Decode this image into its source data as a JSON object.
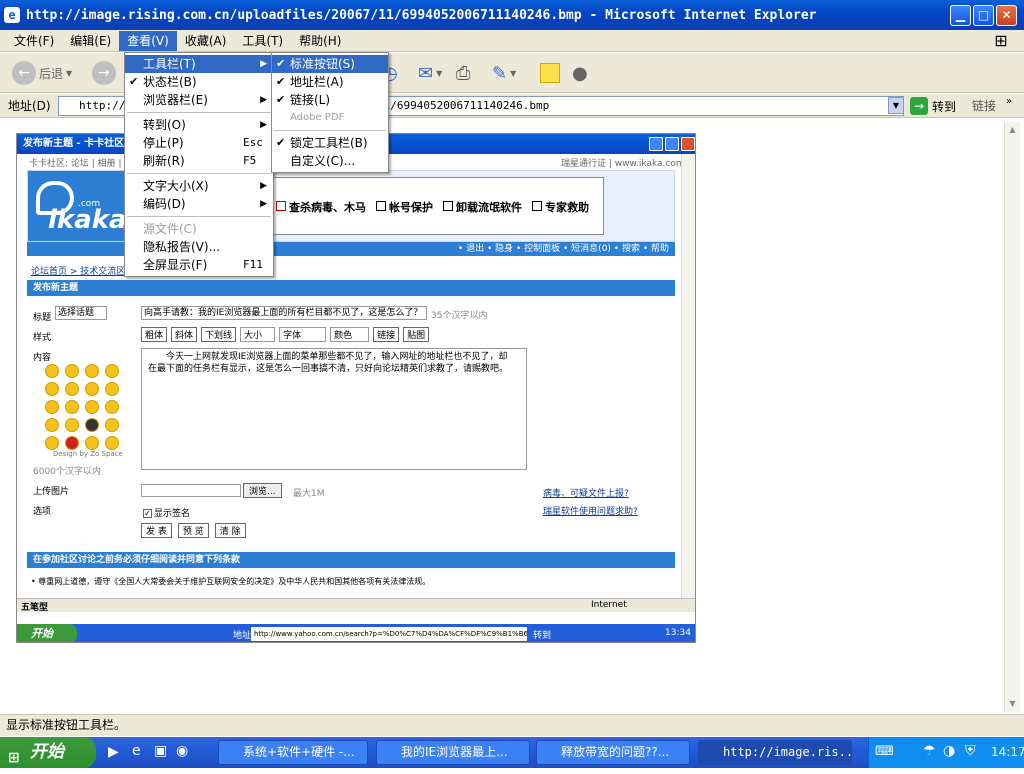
{
  "window": {
    "title": "http://image.rising.com.cn/uploadfiles/20067/11/6994052006711140246.bmp - Microsoft Internet Explorer"
  },
  "menubar": [
    "文件(F)",
    "编辑(E)",
    "查看(V)",
    "收藏(A)",
    "工具(T)",
    "帮助(H)"
  ],
  "toolbar": {
    "back_label": "后退"
  },
  "addressbar": {
    "label": "地址(D)",
    "url": "http://image.rising.com.cn/uploadfiles/20067/11/6994052006711140246.bmp",
    "go_label": "转到",
    "links_label": "链接"
  },
  "view_menu": {
    "items": [
      {
        "label": "工具栏(T)",
        "arrow": "▶",
        "hl": true
      },
      {
        "label": "状态栏(B)",
        "check": "✔"
      },
      {
        "label": "浏览器栏(E)",
        "arrow": "▶"
      },
      {
        "label": "转到(O)",
        "arrow": "▶"
      },
      {
        "label": "停止(P)",
        "shortcut": "Esc"
      },
      {
        "label": "刷新(R)",
        "shortcut": "F5"
      },
      {
        "label": "文字大小(X)",
        "arrow": "▶"
      },
      {
        "label": "编码(D)",
        "arrow": "▶"
      },
      {
        "label": "源文件(C)",
        "dis": true
      },
      {
        "label": "隐私报告(V)..."
      },
      {
        "label": "全屏显示(F)",
        "shortcut": "F11"
      }
    ]
  },
  "toolbar_submenu": {
    "items": [
      {
        "label": "标准按钮(S)",
        "check": "✔",
        "hl": true
      },
      {
        "label": "地址栏(A)",
        "check": "✔"
      },
      {
        "label": "链接(L)",
        "check": "✔"
      },
      {
        "label": "Adobe PDF",
        "dis": true
      },
      {
        "label": "锁定工具栏(B)",
        "check": "✔"
      },
      {
        "label": "自定义(C)..."
      }
    ]
  },
  "status_text": "显示标准按钮工具栏。",
  "taskbar": {
    "start_label": "开始",
    "tasks": [
      "系统+软件+硬件 -...",
      "我的IE浏览器最上...",
      "释放带宽的问题??...",
      "http://image.ris..."
    ],
    "clock": "14:17"
  },
  "shot": {
    "title": "发布新主题 - 卡卡社区",
    "breadcrumb": "卡卡社区: 论坛 | 相册 | ...",
    "top_right": "瑞星通行证 | www.ikaka.com",
    "logo": "ikaka",
    "logo_com": ".com",
    "options": [
      "查杀病毒、木马",
      "帐号保护",
      "卸载流氓软件",
      "专家救助"
    ],
    "nav": "• 退出 • 隐身 • 控制面板 • 短消息(0) • 搜索 • 帮助",
    "crumb2": "论坛首页 > 技术交流区 > ...",
    "section": "发布新主题",
    "lbl_title": "标题",
    "topic_select": "选择话题",
    "subject": "向高手请教：我的IE浏览器最上面的所有栏目都不见了，这是怎么了？",
    "subject_hint": "35个汉字以内",
    "lbl_style": "样式",
    "style_buttons": [
      "粗体",
      "斜体",
      "下划线"
    ],
    "style_selects": [
      "大小",
      "字体",
      "颜色"
    ],
    "link_btn": "链接",
    "img_btn": "贴图",
    "lbl_content": "内容",
    "content": "今天一上网就发现IE浏览器上面的菜单那些都不见了，输入网址的地址栏也不见了，却在最下面的任务栏有显示，这是怎么一回事搞不清，只好向论坛精英们求教了，请赐教吧。",
    "smiley_credit": "Design by Zo Space",
    "content_hint": "6000个汉字以内",
    "lbl_upload": "上传图片",
    "browse": "浏览...",
    "max": "最大1M",
    "lbl_options": "选项",
    "show_sig": "显示签名",
    "submit_buttons": [
      "发 表",
      "预 览",
      "清 除"
    ],
    "q1": "病毒、可疑文件上报?",
    "q2": "瑞星软件使用问题求助?",
    "notice_title": "在参加社区讨论之前务必须仔细阅读并同意下列条款",
    "notice1": "• 尊重网上道德，遵守《全国人大常委会关于维护互联网安全的决定》及中华人民共和国其他各项有关法律法规。",
    "ie_status": "Internet",
    "ime": "五笔型",
    "start_label": "开始",
    "addr_label": "地址",
    "addr_url": "http://www.yahoo.com.cn/search?p=%D0%C7%D4%DA%CF%DF%C9%B1%B6%BE",
    "go": "转到",
    "clock": "13:34"
  }
}
